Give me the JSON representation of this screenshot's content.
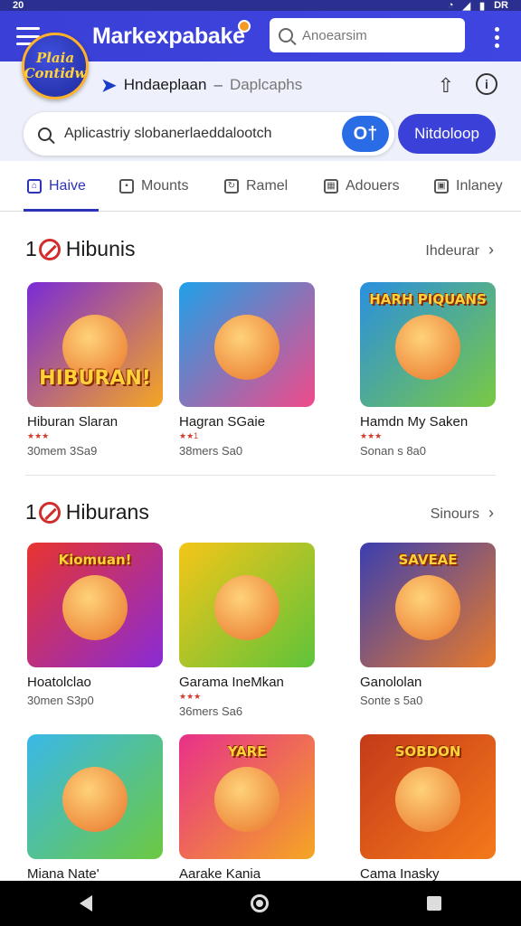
{
  "status": {
    "time": "20",
    "icons": [
      "wifi-icon",
      "signal-icon",
      "battery-icon"
    ],
    "battery": "DR"
  },
  "topbar": {
    "title": "Markexpabake",
    "search_placeholder": "Anoearsim"
  },
  "badge": {
    "line1": "Plaia",
    "line2": "Contidw"
  },
  "subbar": {
    "brand": "Hndaeplaan",
    "separator": "–",
    "subtitle": "Daplcaphs"
  },
  "search": {
    "value": "Aplicastriy slobanerlaeddalootch",
    "toggle_label": "O†",
    "button_label": "Nitdoloop"
  },
  "tabs": [
    {
      "label": "Haive",
      "icon": "home-icon",
      "active": true
    },
    {
      "label": "Mounts",
      "icon": "grid-icon",
      "active": false
    },
    {
      "label": "Ramel",
      "icon": "refresh-icon",
      "active": false
    },
    {
      "label": "Adouers",
      "icon": "calendar-icon",
      "active": false
    },
    {
      "label": "Inlaney",
      "icon": "bag-icon",
      "active": false
    }
  ],
  "sections": [
    {
      "prefix": "1",
      "title": "Hibunis",
      "more": "Ihdeurar",
      "cards": [
        {
          "name": "Hiburan Slaran",
          "stars": "★★★",
          "meta": "30mem 3Sa9",
          "art": "HIBURAN!",
          "colors": [
            "#7a2bd6",
            "#f5a623"
          ]
        },
        {
          "name": "Hagran SGaie",
          "stars": "★★1",
          "meta": "38mers Sa0",
          "art": "",
          "colors": [
            "#1fa0e8",
            "#f04a8a"
          ]
        },
        {
          "name": "Hamdn My Saken",
          "stars": "★★★",
          "meta": "Sonan s 8a0",
          "art": "HARH PIQUANS",
          "colors": [
            "#2a8fe0",
            "#79c943"
          ]
        }
      ]
    },
    {
      "prefix": "1",
      "title": "Hiburans",
      "more": "Sinours",
      "cards": [
        {
          "name": "Hoatolclao",
          "stars": "",
          "meta": "30men S3p0",
          "art": "Kiomuan!",
          "colors": [
            "#e8342f",
            "#8a2bd6"
          ]
        },
        {
          "name": "Garama IneMkan",
          "stars": "★★★",
          "meta": "36mers Sa6",
          "art": "",
          "colors": [
            "#f5c518",
            "#5ec43a"
          ]
        },
        {
          "name": "Ganololan",
          "stars": "",
          "meta": "Sonte s 5a0",
          "art": "SAVEAE",
          "colors": [
            "#3b3fb0",
            "#e87a2a"
          ]
        }
      ]
    },
    {
      "prefix": "",
      "title": "",
      "more": "",
      "cards": [
        {
          "name": "Miana Nate'",
          "stars": "",
          "meta": "",
          "art": "",
          "colors": [
            "#3ab8e8",
            "#6cc940"
          ]
        },
        {
          "name": "Aarake Kania",
          "stars": "",
          "meta": "",
          "art": "YARE",
          "colors": [
            "#e8308a",
            "#f5a623"
          ]
        },
        {
          "name": "Cama Inasky",
          "stars": "",
          "meta": "",
          "art": "SOBDON",
          "colors": [
            "#c43a1a",
            "#f57a1a"
          ]
        }
      ]
    }
  ]
}
